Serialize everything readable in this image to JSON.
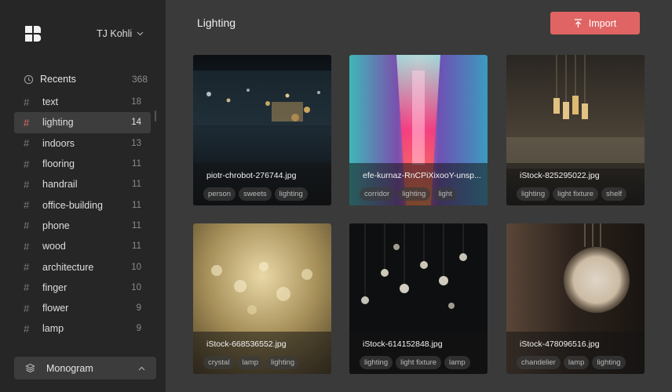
{
  "sidebar": {
    "user_name": "TJ Kohli",
    "recents": {
      "label": "Recents",
      "count": "368"
    },
    "tags": [
      {
        "label": "text",
        "count": "18"
      },
      {
        "label": "lighting",
        "count": "14"
      },
      {
        "label": "indoors",
        "count": "13"
      },
      {
        "label": "flooring",
        "count": "11"
      },
      {
        "label": "handrail",
        "count": "11"
      },
      {
        "label": "office-building",
        "count": "11"
      },
      {
        "label": "phone",
        "count": "11"
      },
      {
        "label": "wood",
        "count": "11"
      },
      {
        "label": "architecture",
        "count": "10"
      },
      {
        "label": "finger",
        "count": "10"
      },
      {
        "label": "flower",
        "count": "9"
      },
      {
        "label": "lamp",
        "count": "9"
      }
    ],
    "active_tag": "lighting",
    "library_label": "Monogram"
  },
  "header": {
    "title": "Lighting",
    "import_label": "Import"
  },
  "cards": [
    {
      "filename": "piotr-chrobot-276744.jpg",
      "tags": [
        "person",
        "sweets",
        "lighting"
      ]
    },
    {
      "filename": "efe-kurnaz-RnCPiXixooY-unsp...",
      "tags": [
        "corridor",
        "lighting",
        "light"
      ]
    },
    {
      "filename": "iStock-825295022.jpg",
      "tags": [
        "lighting",
        "light fixture",
        "shelf"
      ]
    },
    {
      "filename": "iStock-668536552.jpg",
      "tags": [
        "crystal",
        "lamp",
        "lighting"
      ]
    },
    {
      "filename": "iStock-614152848.jpg",
      "tags": [
        "lighting",
        "light fixture",
        "lamp"
      ]
    },
    {
      "filename": "iStock-478096516.jpg",
      "tags": [
        "chandelier",
        "lamp",
        "lighting"
      ]
    }
  ],
  "colors": {
    "accent": "#e06464",
    "sidebar_bg": "#262626",
    "main_bg": "#3a3a3a"
  }
}
